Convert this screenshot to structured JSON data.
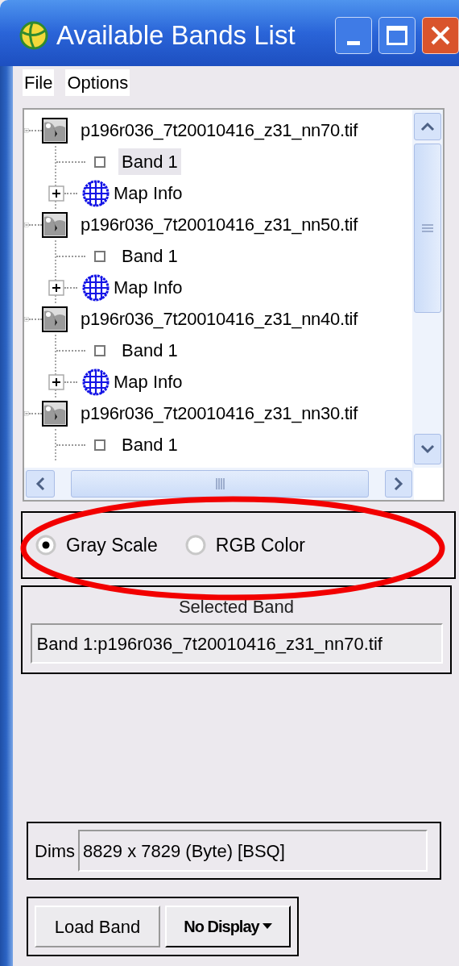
{
  "window": {
    "title": "Available Bands List"
  },
  "menu": [
    "File",
    "Options"
  ],
  "tree": [
    {
      "label": "p196r036_7t20010416_z31_nn70.tif",
      "kind": "file",
      "expanded": true,
      "children": [
        {
          "label": "Band 1",
          "kind": "band",
          "selected": true
        },
        {
          "label": "Map Info",
          "kind": "map_info",
          "expanded": false
        }
      ]
    },
    {
      "label": "p196r036_7t20010416_z31_nn50.tif",
      "kind": "file",
      "expanded": true,
      "children": [
        {
          "label": "Band 1",
          "kind": "band",
          "selected": false
        },
        {
          "label": "Map Info",
          "kind": "map_info",
          "expanded": false
        }
      ]
    },
    {
      "label": "p196r036_7t20010416_z31_nn40.tif",
      "kind": "file",
      "expanded": true,
      "children": [
        {
          "label": "Band 1",
          "kind": "band",
          "selected": false
        },
        {
          "label": "Map Info",
          "kind": "map_info",
          "expanded": false
        }
      ]
    },
    {
      "label": "p196r036_7t20010416_z31_nn30.tif",
      "kind": "file",
      "expanded": true,
      "children": [
        {
          "label": "Band 1",
          "kind": "band",
          "selected": false
        }
      ]
    }
  ],
  "display_mode": [
    {
      "label": "Gray Scale",
      "selected": true
    },
    {
      "label": "RGB Color",
      "selected": false
    }
  ],
  "selected_band": {
    "title": "Selected Band",
    "value": "Band 1:p196r036_7t20010416_z31_nn70.tif"
  },
  "dims": {
    "label": "Dims",
    "value": "8829 x 7829 (Byte) [BSQ]"
  },
  "buttons": {
    "load": "Load Band",
    "display": "No Display"
  }
}
